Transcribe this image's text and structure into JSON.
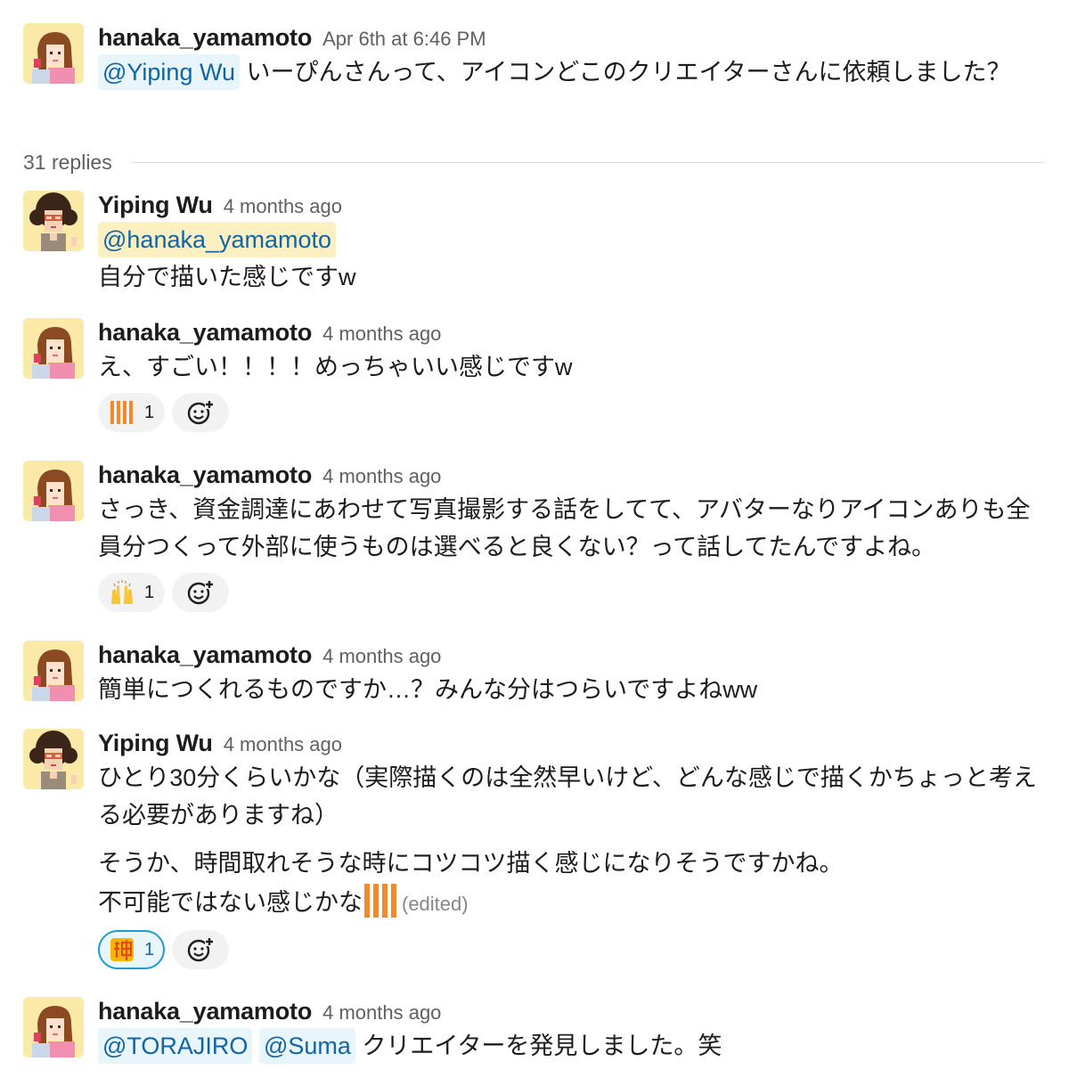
{
  "thread": {
    "replies_label": "31 replies",
    "parent": {
      "author": "hanaka_yamamoto",
      "timestamp": "Apr 6th at 6:46 PM",
      "mention": "@Yiping Wu",
      "text": " いーぴんさんって、アイコンどこのクリエイターさんに依頼しました？"
    },
    "replies": [
      {
        "author": "Yiping Wu",
        "timestamp": "4 months ago",
        "mention": "@hanaka_yamamoto",
        "text": "自分で描いた感じですw"
      },
      {
        "author": "hanaka_yamamoto",
        "timestamp": "4 months ago",
        "text": "え、すごい！！！！めっちゃいい感じですw",
        "reaction": {
          "emoji": "www-emoji",
          "count": "1"
        }
      },
      {
        "author": "hanaka_yamamoto",
        "timestamp": "4 months ago",
        "text": "さっき、資金調達にあわせて写真撮影する話をしてて、アバターなりアイコンありも全員分つくって外部に使うものは選べると良くない？って話してたんですよね。",
        "reaction": {
          "emoji": "raised-hands-emoji",
          "count": "1"
        }
      },
      {
        "author": "hanaka_yamamoto",
        "timestamp": "4 months ago",
        "text": "簡単につくれるものですか…？みんな分はつらいですよねww"
      },
      {
        "author": "Yiping Wu",
        "timestamp": "4 months ago",
        "text": "ひとり30分くらいかな（実際描くのは全然早いけど、どんな感じで描くかちょっと考える必要がありますね）",
        "text2_line1": "そうか、時間取れそうな時にコツコツ描く感じになりそうですかね。",
        "text2_line2": "不可能ではない感じかな",
        "edited": "(edited)",
        "reaction": {
          "emoji": "kami-emoji",
          "count": "1"
        }
      },
      {
        "author": "hanaka_yamamoto",
        "timestamp": "4 months ago",
        "mention1": "@TORAJIRO",
        "mention2": "@Suma",
        "text": " クリエイターを発見しました。笑"
      }
    ]
  },
  "colors": {
    "mention_bg": "#e8f5fa",
    "mention_self_bg": "#fcefc2",
    "link": "#1264a3",
    "timestamp": "#616061"
  },
  "icons": {
    "add_reaction": "add-reaction-icon",
    "hanaka_avatar": "avatar-hanaka",
    "yiping_avatar": "avatar-yiping"
  }
}
